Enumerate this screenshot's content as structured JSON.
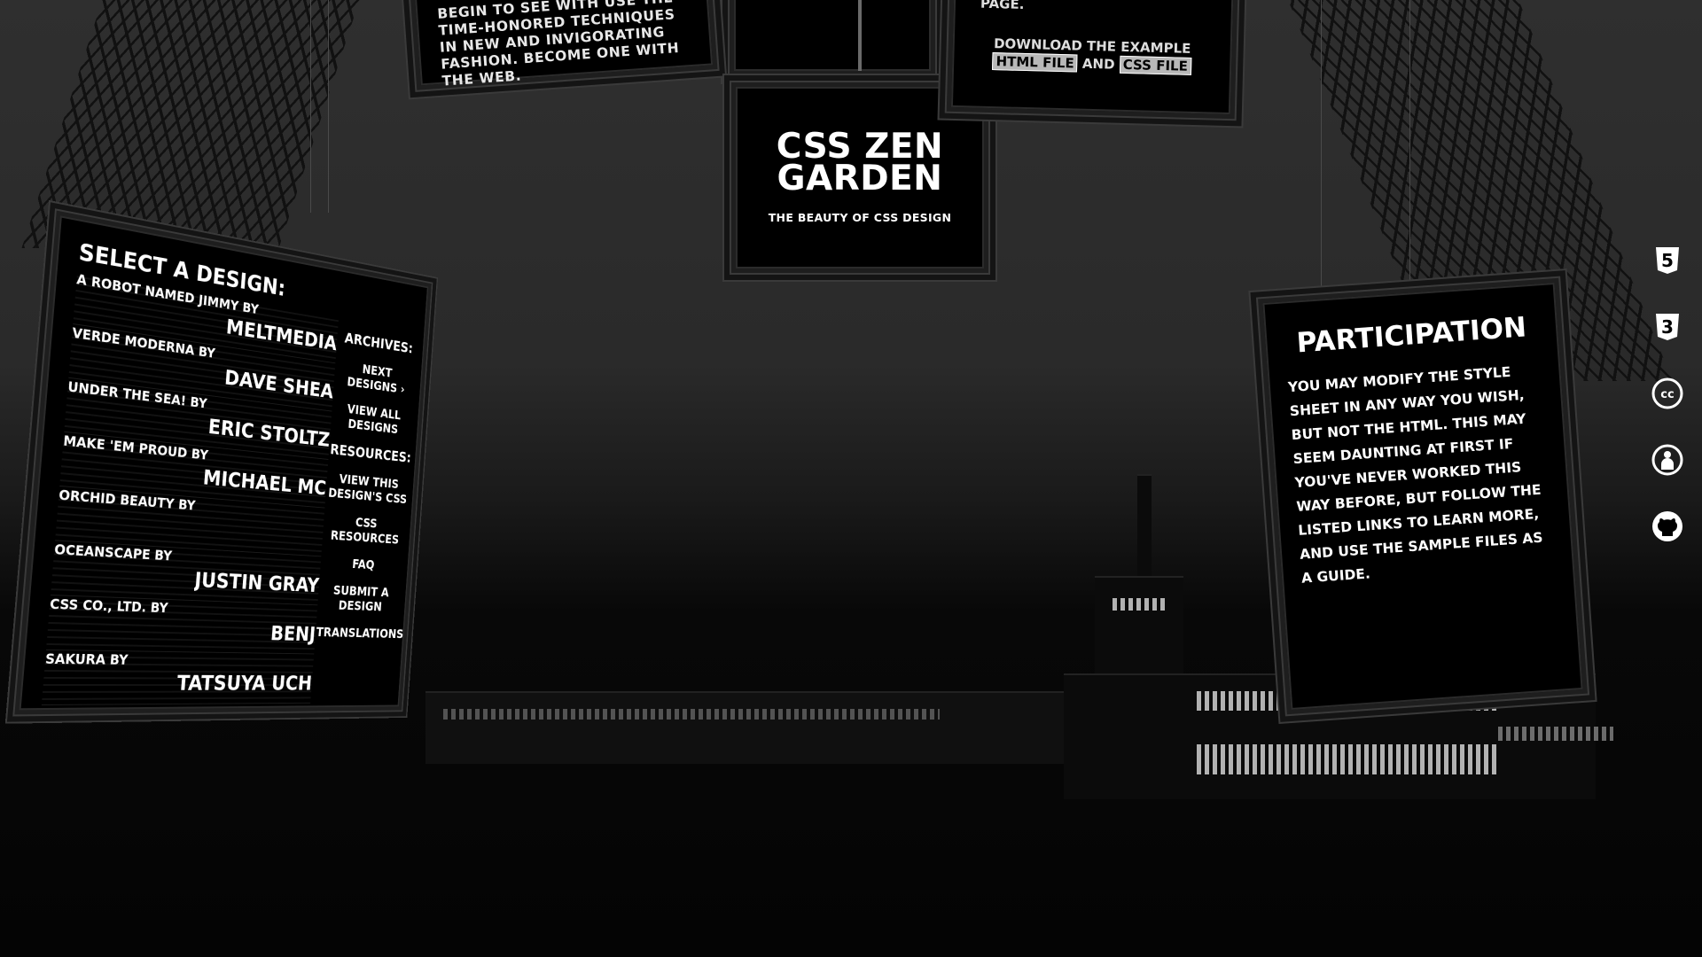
{
  "intro": {
    "text": "BEGIN TO SEE WITH USE THE TIME-HONORED TECHNIQUES IN NEW AND INVIGORATING FASHION. BECOME ONE WITH THE WEB."
  },
  "header": {
    "title": "CSS ZEN GARDEN",
    "tagline": "THE BEAUTY OF CSS DESIGN"
  },
  "download": {
    "page_word": "PAGE.",
    "prefix": "DOWNLOAD THE EXAMPLE",
    "html_file": "HTML FILE",
    "conjunction": "AND",
    "css_file": "CSS FILE"
  },
  "designs": {
    "title": "SELECT A DESIGN:",
    "items": [
      {
        "name": "A ROBOT NAMED JIMMY BY",
        "author": "MELTMEDIA"
      },
      {
        "name": "VERDE MODERNA BY",
        "author": "DAVE SHEA"
      },
      {
        "name": "UNDER THE SEA! BY",
        "author": "ERIC STOLTZ"
      },
      {
        "name": "MAKE 'EM PROUD BY",
        "author": "MICHAEL MC"
      },
      {
        "name": "ORCHID BEAUTY BY",
        "author": ""
      },
      {
        "name": "OCEANSCAPE BY",
        "author": "JUSTIN GRAY"
      },
      {
        "name": "CSS CO., LTD. BY",
        "author": "BENJ"
      },
      {
        "name": "SAKURA BY",
        "author": "TATSUYA UCH"
      }
    ]
  },
  "nav": {
    "archives": "ARCHIVES:",
    "next": "NEXT DESIGNS ›",
    "view_all": "VIEW ALL DESIGNS",
    "resources": "RESOURCES:",
    "view_css": "VIEW THIS DESIGN'S CSS",
    "css_resources": "CSS RESOURCES",
    "faq": "FAQ",
    "submit": "SUBMIT A DESIGN",
    "translations": "TRANSLATIONS"
  },
  "participation": {
    "title": "PARTICIPATION",
    "text": "YOU MAY MODIFY THE STYLE SHEET IN ANY WAY YOU WISH, BUT NOT THE HTML. THIS MAY SEEM DAUNTING AT FIRST IF YOU'VE NEVER WORKED THIS WAY BEFORE, BUT FOLLOW THE LISTED LINKS TO LEARN MORE, AND USE THE SAMPLE FILES AS A GUIDE."
  },
  "icons": [
    "html5-icon",
    "css3-icon",
    "creative-commons-icon",
    "accessibility-icon",
    "github-icon"
  ]
}
